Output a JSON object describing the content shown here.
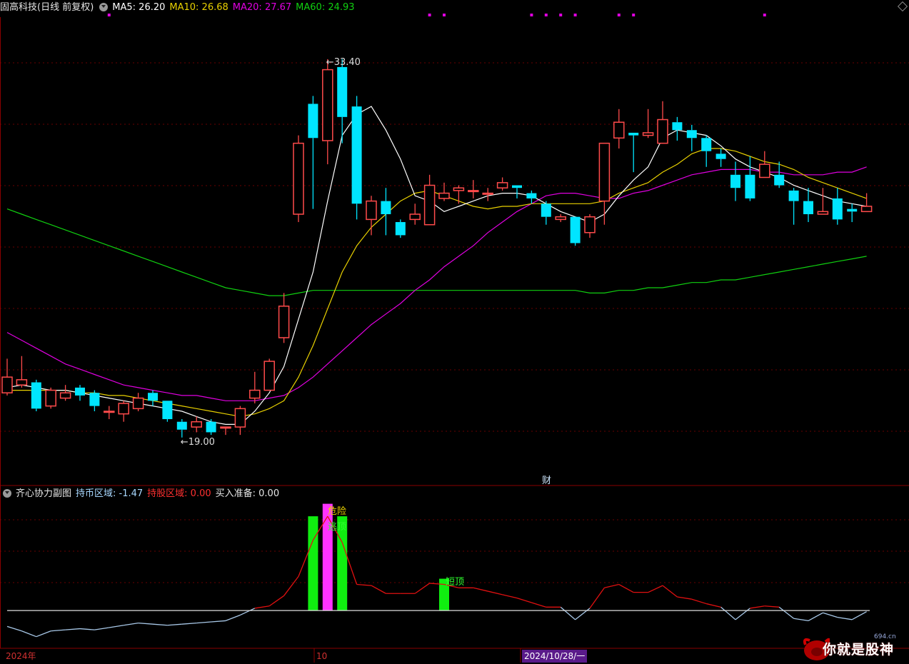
{
  "header": {
    "title": "固高科技(日线 前复权)",
    "ma5": "MA5: 26.20",
    "ma10": "MA10: 26.68",
    "ma20": "MA20: 27.67",
    "ma60": "MA60: 24.93"
  },
  "sub_header": {
    "title": "齐心协力副图",
    "hold_market": "持币区域: -1.47",
    "hold_stock": "持股区域: 0.00",
    "buy_ready": "买入准备: 0.00"
  },
  "annotations": {
    "high": "33.40",
    "low": "19.00",
    "fin": "财",
    "danger": "危险",
    "top1": "逃顶",
    "top2": "短顶"
  },
  "x_labels": {
    "year": "2024年",
    "month": "10",
    "date": "2024/10/28/一"
  },
  "watermark": {
    "text": "你就是股神",
    "site": "694.cn"
  },
  "colors": {
    "up": "#ff4b4b",
    "down": "#00e5ff",
    "ma5": "#ffffff",
    "ma10": "#e8d000",
    "ma20": "#e000e0",
    "ma60": "#10d010",
    "signal_line": "#e01010",
    "zero_line": "#dddddd"
  },
  "chart_data": [
    {
      "type": "candlestick",
      "title": "固高科技(日线 前复权)",
      "ylim": [
        17.5,
        35
      ],
      "candles": [
        [
          20.7,
          21.3,
          20.6,
          22.0
        ],
        [
          21.0,
          21.2,
          20.9,
          22.1
        ],
        [
          21.1,
          20.1,
          20.0,
          21.2
        ],
        [
          20.2,
          20.8,
          20.1,
          20.9
        ],
        [
          20.5,
          20.7,
          20.4,
          21.0
        ],
        [
          20.9,
          20.6,
          20.4,
          21.0
        ],
        [
          20.7,
          20.2,
          20.0,
          20.8
        ],
        [
          20.0,
          20.0,
          19.7,
          20.2
        ],
        [
          19.9,
          20.3,
          19.6,
          20.4
        ],
        [
          20.1,
          20.5,
          20.0,
          20.7
        ],
        [
          20.7,
          20.4,
          20.2,
          20.8
        ],
        [
          20.4,
          19.7,
          19.6,
          20.4
        ],
        [
          19.6,
          19.3,
          19.0,
          19.7
        ],
        [
          19.4,
          19.6,
          19.2,
          19.8
        ],
        [
          19.6,
          19.2,
          19.1,
          19.7
        ],
        [
          19.4,
          19.4,
          19.1,
          19.4
        ],
        [
          19.4,
          20.1,
          19.1,
          20.2
        ],
        [
          20.5,
          20.8,
          20.3,
          21.5
        ],
        [
          20.8,
          21.9,
          20.8,
          22.0
        ],
        [
          22.8,
          24.0,
          22.6,
          24.5
        ],
        [
          27.5,
          30.2,
          27.2,
          30.5
        ],
        [
          31.7,
          30.4,
          27.7,
          32.0
        ],
        [
          30.3,
          33.0,
          29.4,
          33.4
        ],
        [
          33.1,
          31.2,
          30.2,
          33.4
        ],
        [
          31.6,
          27.9,
          27.3,
          32.0
        ],
        [
          27.3,
          28.0,
          26.7,
          28.2
        ],
        [
          28.0,
          27.5,
          26.7,
          28.5
        ],
        [
          27.2,
          26.7,
          26.6,
          27.3
        ],
        [
          27.3,
          27.5,
          27.1,
          27.9
        ],
        [
          27.1,
          28.6,
          27.1,
          29.0
        ],
        [
          28.1,
          28.3,
          28.0,
          28.7
        ],
        [
          28.4,
          28.5,
          27.9,
          28.6
        ],
        [
          28.4,
          28.4,
          28.1,
          28.8
        ],
        [
          28.3,
          28.3,
          28.0,
          28.5
        ],
        [
          28.5,
          28.7,
          28.4,
          28.9
        ],
        [
          28.6,
          28.5,
          28.1,
          28.6
        ],
        [
          28.3,
          28.1,
          27.9,
          28.4
        ],
        [
          27.9,
          27.4,
          27.1,
          28.0
        ],
        [
          27.3,
          27.4,
          27.2,
          27.5
        ],
        [
          27.4,
          26.4,
          26.3,
          27.4
        ],
        [
          26.8,
          27.4,
          26.6,
          27.5
        ],
        [
          28.0,
          30.2,
          27.1,
          30.2
        ],
        [
          30.4,
          31.0,
          30.0,
          31.5
        ],
        [
          30.6,
          30.5,
          29.1,
          30.6
        ],
        [
          30.5,
          30.6,
          30.4,
          31.5
        ],
        [
          30.2,
          31.1,
          30.5,
          31.8
        ],
        [
          31.0,
          30.7,
          30.3,
          31.2
        ],
        [
          30.7,
          30.4,
          29.9,
          30.9
        ],
        [
          30.4,
          29.9,
          29.3,
          30.5
        ],
        [
          29.8,
          29.6,
          29.3,
          30.0
        ],
        [
          29.0,
          28.5,
          28.0,
          29.5
        ],
        [
          29.0,
          28.1,
          28.0,
          29.7
        ],
        [
          28.9,
          29.4,
          29.2,
          29.9
        ],
        [
          29.0,
          28.6,
          28.5,
          29.5
        ],
        [
          28.4,
          28.0,
          27.1,
          28.5
        ],
        [
          28.0,
          27.5,
          27.2,
          28.5
        ],
        [
          27.5,
          27.6,
          27.6,
          28.5
        ],
        [
          28.1,
          27.3,
          27.1,
          28.5
        ],
        [
          27.7,
          27.6,
          27.2,
          27.9
        ],
        [
          27.6,
          27.8,
          27.7,
          28.3
        ]
      ],
      "ma5": [
        20.9,
        21.0,
        20.9,
        20.8,
        20.8,
        20.7,
        20.6,
        20.5,
        20.4,
        20.3,
        20.2,
        20.1,
        20.0,
        19.8,
        19.6,
        19.5,
        19.5,
        20.0,
        20.7,
        21.7,
        23.5,
        25.3,
        28.0,
        30.5,
        31.3,
        31.6,
        30.7,
        29.6,
        28.2,
        28.0,
        27.6,
        27.8,
        28.0,
        28.2,
        28.3,
        28.3,
        28.2,
        27.9,
        27.6,
        27.4,
        27.2,
        27.5,
        28.2,
        28.8,
        29.3,
        30.4,
        30.7,
        30.6,
        30.5,
        30.1,
        29.6,
        29.3,
        29.1,
        28.9,
        28.6,
        28.4,
        28.2,
        28.0,
        27.9,
        27.8
      ],
      "ma10": [
        20.8,
        20.8,
        20.8,
        20.8,
        20.8,
        20.7,
        20.7,
        20.6,
        20.6,
        20.5,
        20.4,
        20.3,
        20.2,
        20.1,
        20.0,
        19.9,
        19.8,
        19.9,
        20.1,
        20.4,
        21.3,
        22.5,
        23.9,
        25.3,
        26.3,
        27.0,
        27.5,
        28.0,
        28.3,
        28.4,
        28.2,
        28.0,
        27.8,
        27.7,
        27.8,
        27.8,
        27.9,
        27.9,
        27.9,
        27.9,
        27.9,
        28.0,
        28.3,
        28.5,
        28.7,
        29.1,
        29.4,
        29.8,
        30.0,
        30.0,
        29.9,
        29.7,
        29.5,
        29.4,
        29.2,
        28.9,
        28.7,
        28.5,
        28.3,
        28.1
      ],
      "ma20": [
        23.0,
        22.7,
        22.4,
        22.1,
        21.8,
        21.6,
        21.4,
        21.2,
        21.0,
        20.9,
        20.8,
        20.7,
        20.6,
        20.6,
        20.5,
        20.4,
        20.4,
        20.4,
        20.5,
        20.6,
        20.9,
        21.3,
        21.8,
        22.3,
        22.8,
        23.3,
        23.7,
        24.1,
        24.6,
        25.0,
        25.5,
        25.9,
        26.3,
        26.8,
        27.2,
        27.6,
        27.9,
        28.2,
        28.3,
        28.3,
        28.2,
        28.1,
        28.1,
        28.3,
        28.4,
        28.6,
        28.8,
        29.0,
        29.1,
        29.2,
        29.2,
        29.2,
        29.1,
        29.1,
        29.0,
        29.0,
        29.0,
        29.1,
        29.1,
        29.3
      ],
      "ma60": [
        27.7,
        27.5,
        27.3,
        27.1,
        26.9,
        26.7,
        26.5,
        26.3,
        26.1,
        25.9,
        25.7,
        25.5,
        25.3,
        25.1,
        24.9,
        24.7,
        24.6,
        24.5,
        24.4,
        24.4,
        24.5,
        24.6,
        24.6,
        24.6,
        24.6,
        24.6,
        24.6,
        24.6,
        24.6,
        24.6,
        24.6,
        24.6,
        24.6,
        24.6,
        24.6,
        24.6,
        24.6,
        24.6,
        24.6,
        24.6,
        24.5,
        24.5,
        24.6,
        24.6,
        24.7,
        24.7,
        24.8,
        24.9,
        24.9,
        25.0,
        25.0,
        25.1,
        25.2,
        25.3,
        25.4,
        25.5,
        25.6,
        25.7,
        25.8,
        25.9
      ]
    },
    {
      "type": "line",
      "title": "齐心协力副图",
      "ylim": [
        -3.2,
        9.5
      ],
      "baseline": 0,
      "signal": [
        -1.4,
        -1.8,
        -2.3,
        -1.8,
        -1.7,
        -1.6,
        -1.7,
        -1.5,
        -1.3,
        -1.1,
        -1.2,
        -1.3,
        -1.2,
        -1.1,
        -1.0,
        -0.9,
        -0.4,
        0.2,
        0.4,
        1.3,
        3.0,
        6.2,
        8.3,
        6.0,
        2.3,
        2.2,
        1.5,
        1.5,
        1.5,
        2.4,
        2.3,
        2.0,
        2.0,
        1.7,
        1.4,
        1.1,
        0.7,
        0.3,
        0.3,
        -0.8,
        0.2,
        2.0,
        2.3,
        1.6,
        1.6,
        2.2,
        1.2,
        1.0,
        0.6,
        0.3,
        -0.8,
        0.2,
        0.4,
        0.3,
        -0.7,
        -0.9,
        -0.2,
        -0.6,
        -0.8,
        -0.1
      ],
      "bars": [
        {
          "index": 21,
          "value": 8.3,
          "color": "#10ee10"
        },
        {
          "index": 22,
          "value": 9.4,
          "color": "#ff33ff"
        },
        {
          "index": 23,
          "value": 8.3,
          "color": "#10ee10"
        },
        {
          "index": 30,
          "value": 2.8,
          "color": "#10ee10"
        }
      ]
    }
  ]
}
